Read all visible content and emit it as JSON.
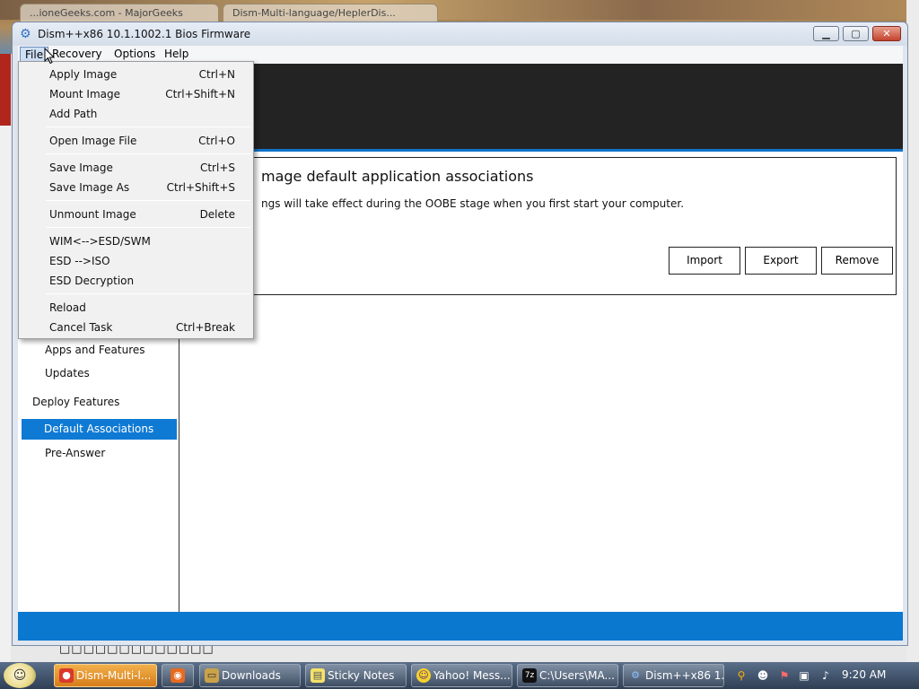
{
  "background_browser": {
    "tabs": [
      "...ioneGeeks.com - MajorGeeks",
      "Dism-Multi-language/HeplerDis..."
    ],
    "garbled_text": "□□□□□□□□□□□□□"
  },
  "window": {
    "title": "Dism++x86 10.1.1002.1 Bios Firmware",
    "controls": {
      "minimize": "▁",
      "maximize": "▢",
      "close": "✕"
    }
  },
  "menubar": {
    "file": "File",
    "recovery": "Recovery",
    "options": "Options",
    "help": "Help"
  },
  "file_menu": {
    "items": [
      {
        "label": "Apply Image",
        "shortcut": "Ctrl+N"
      },
      {
        "label": "Mount Image",
        "shortcut": "Ctrl+Shift+N"
      },
      {
        "label": "Add Path",
        "shortcut": ""
      },
      {
        "label": "Open Image File",
        "shortcut": "Ctrl+O"
      },
      {
        "label": "Save Image",
        "shortcut": "Ctrl+S"
      },
      {
        "label": "Save Image As",
        "shortcut": "Ctrl+Shift+S"
      },
      {
        "label": "Unmount Image",
        "shortcut": "Delete"
      },
      {
        "label": "WIM<-->ESD/SWM",
        "shortcut": ""
      },
      {
        "label": "ESD -->ISO",
        "shortcut": ""
      },
      {
        "label": "ESD Decryption",
        "shortcut": ""
      },
      {
        "label": "Reload",
        "shortcut": ""
      },
      {
        "label": "Cancel Task",
        "shortcut": "Ctrl+Break"
      }
    ]
  },
  "sidebar": {
    "apps_features": "Apps and Features",
    "updates": "Updates",
    "deploy_features": "Deploy Features",
    "default_associations": "Default Associations",
    "pre_answer": "Pre-Answer"
  },
  "panel": {
    "title": "mage default application associations",
    "description": "ngs will take effect during the OOBE stage when you first start your computer.",
    "buttons": {
      "import": "Import",
      "export": "Export",
      "remove": "Remove"
    }
  },
  "taskbar": {
    "buttons": [
      {
        "label": "Dism-Multi-l...",
        "icon": "chrome-icon"
      },
      {
        "label": "",
        "icon": "firefox-icon"
      },
      {
        "label": "Downloads",
        "icon": "folder-icon"
      },
      {
        "label": "Sticky Notes",
        "icon": "sticky-notes-icon"
      },
      {
        "label": "Yahoo! Mess...",
        "icon": "yahoo-messenger-icon"
      },
      {
        "label": "C:\\Users\\MA...",
        "icon": "7zip-icon"
      },
      {
        "label": "Dism++x86 1...",
        "icon": "dism-icon"
      }
    ],
    "clock": "9:20 AM"
  },
  "colors": {
    "accent_blue": "#0f7ad4",
    "header_dark": "#232323",
    "taskbar_active": "#e0902a"
  }
}
